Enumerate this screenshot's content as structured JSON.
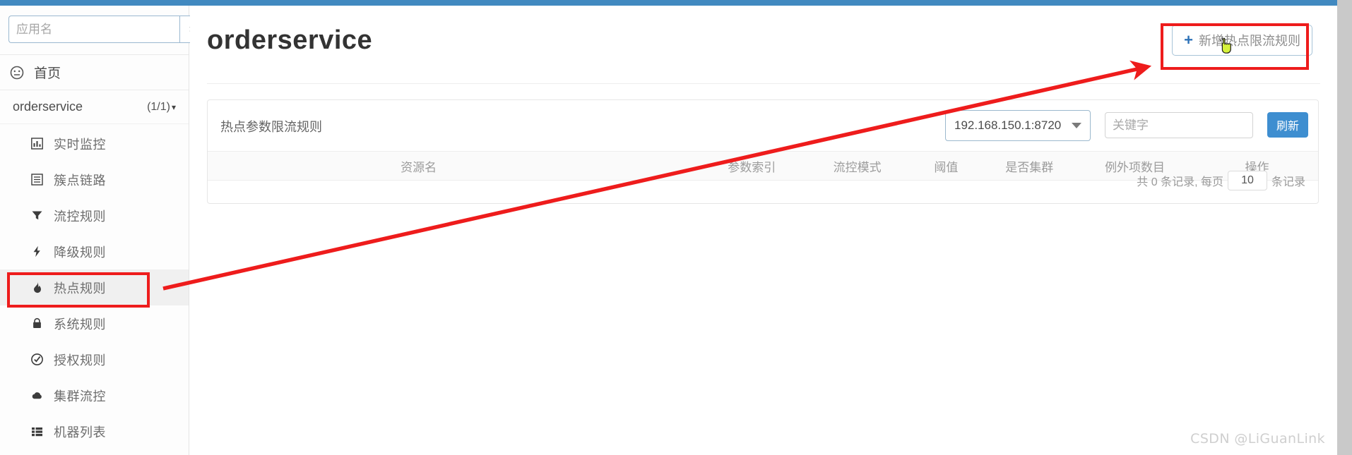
{
  "topbar": {
    "color": "#4189c0"
  },
  "sidebar": {
    "search": {
      "placeholder": "应用名",
      "value": "",
      "button_label": "搜索"
    },
    "home": {
      "label": "首页",
      "icon": "dashboard-icon"
    },
    "app_group": {
      "name": "orderservice",
      "count": "(1/1)",
      "chevron": "chevron-down-icon"
    },
    "items": [
      {
        "label": "实时监控",
        "icon": "bar-chart-icon",
        "active": false
      },
      {
        "label": "簇点链路",
        "icon": "list-icon",
        "active": false
      },
      {
        "label": "流控规则",
        "icon": "filter-icon",
        "active": false
      },
      {
        "label": "降级规则",
        "icon": "bolt-icon",
        "active": false
      },
      {
        "label": "热点规则",
        "icon": "fire-icon",
        "active": true
      },
      {
        "label": "系统规则",
        "icon": "lock-icon",
        "active": false
      },
      {
        "label": "授权规则",
        "icon": "check-circle-icon",
        "active": false
      },
      {
        "label": "集群流控",
        "icon": "cloud-icon",
        "active": false
      },
      {
        "label": "机器列表",
        "icon": "grid-list-icon",
        "active": false
      }
    ]
  },
  "main": {
    "page_title": "orderservice",
    "add_button": {
      "label": "新增热点限流规则",
      "plus": "+"
    },
    "card": {
      "title": "热点参数限流规则",
      "machine_select": {
        "value": "192.168.150.1:8720",
        "caret": "caret-down-icon"
      },
      "keyword_input": {
        "placeholder": "关键字",
        "value": ""
      },
      "refresh_button": "刷新",
      "table": {
        "headers": [
          "",
          "资源名",
          "",
          "参数索引",
          "流控模式",
          "阈值",
          "是否集群",
          "例外项数目",
          "操作"
        ],
        "rows": []
      },
      "pager": {
        "prefix": "共 0 条记录, 每页",
        "page_size": "10",
        "suffix": "条记录"
      }
    }
  },
  "annotations": {
    "highlight_color": "#ee1c1c",
    "menu_box": "热点规则",
    "button_box": "新增热点限流规则"
  },
  "watermark": "CSDN @LiGuanLink"
}
